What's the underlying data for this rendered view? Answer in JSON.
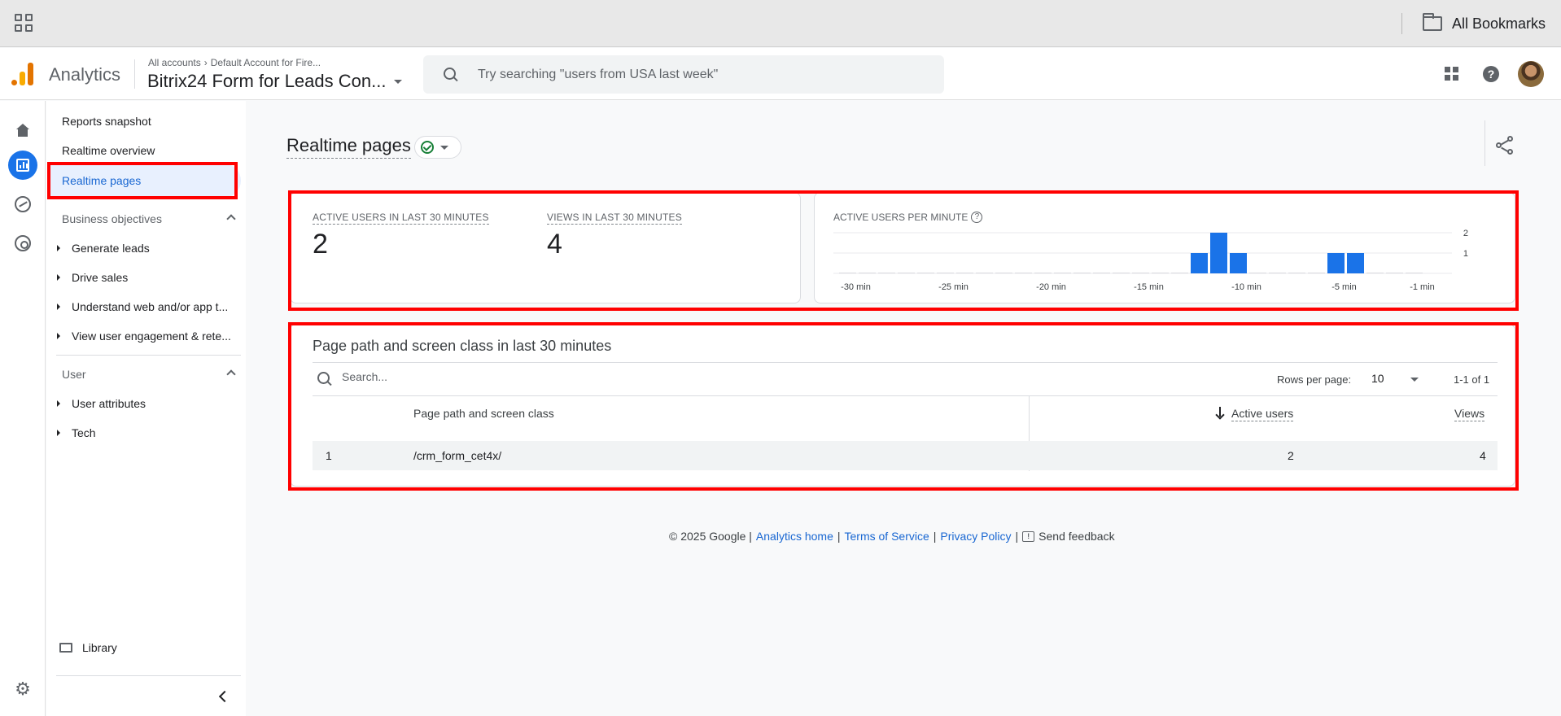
{
  "browser": {
    "bookmarks_label": "All Bookmarks",
    "icons": {
      "apps": "apps-grid-icon",
      "folder": "folder-icon"
    }
  },
  "header": {
    "app_name": "Analytics",
    "breadcrumb_account": "All accounts",
    "breadcrumb_property": "Default Account for Fire...",
    "property_name": "Bitrix24 Form for Leads Con...",
    "search_placeholder": "Try searching \"users from USA last week\""
  },
  "nav": {
    "reports_snapshot": "Reports snapshot",
    "realtime_overview": "Realtime overview",
    "realtime_pages": "Realtime pages",
    "section_business": "Business objectives",
    "business_items": [
      "Generate leads",
      "Drive sales",
      "Understand web and/or app t...",
      "View user engagement & rete..."
    ],
    "section_user": "User",
    "user_items": [
      "User attributes",
      "Tech"
    ],
    "library": "Library"
  },
  "main": {
    "page_title": "Realtime pages",
    "kpis": [
      {
        "label": "ACTIVE USERS IN LAST 30 MINUTES",
        "value": "2"
      },
      {
        "label": "VIEWS IN LAST 30 MINUTES",
        "value": "4"
      }
    ],
    "chart_title": "ACTIVE USERS PER MINUTE",
    "table": {
      "title": "Page path and screen class in last 30 minutes",
      "search_placeholder": "Search...",
      "rows_per_page_label": "Rows per page:",
      "rows_per_page_value": "10",
      "pagination": "1-1 of 1",
      "columns": [
        "Page path and screen class",
        "Active users",
        "Views"
      ],
      "rows": [
        {
          "index": "1",
          "path": "/crm_form_cet4x/",
          "active_users": "2",
          "views": "4"
        }
      ]
    }
  },
  "footer": {
    "copyright": "© 2025 Google |",
    "analytics_home": "Analytics home",
    "sep1": "|",
    "terms": "Terms of Service",
    "sep2": "|",
    "privacy": "Privacy Policy",
    "sep3": "|",
    "feedback": "Send feedback"
  },
  "colors": {
    "accent": "#1a73e8",
    "highlight_box": "#ff0000",
    "bar": "#1a73e8"
  },
  "chart_data": {
    "type": "bar",
    "title": "ACTIVE USERS PER MINUTE",
    "x_tick_labels": [
      "-30 min",
      "-25 min",
      "-20 min",
      "-15 min",
      "-10 min",
      "-5 min",
      "-1 min"
    ],
    "y_tick_labels": [
      "2",
      "1"
    ],
    "ylim": [
      0,
      2
    ],
    "categories": [
      "-30",
      "-29",
      "-28",
      "-27",
      "-26",
      "-25",
      "-24",
      "-23",
      "-22",
      "-21",
      "-20",
      "-19",
      "-18",
      "-17",
      "-16",
      "-15",
      "-14",
      "-13",
      "-12",
      "-11",
      "-10",
      "-9",
      "-8",
      "-7",
      "-6",
      "-5",
      "-4",
      "-3",
      "-2",
      "-1"
    ],
    "values": [
      0,
      0,
      0,
      0,
      0,
      0,
      0,
      0,
      0,
      0,
      0,
      0,
      0,
      0,
      0,
      0,
      0,
      0,
      1,
      2,
      1,
      0,
      0,
      0,
      0,
      1,
      1,
      0,
      0,
      0
    ],
    "grid": true
  }
}
